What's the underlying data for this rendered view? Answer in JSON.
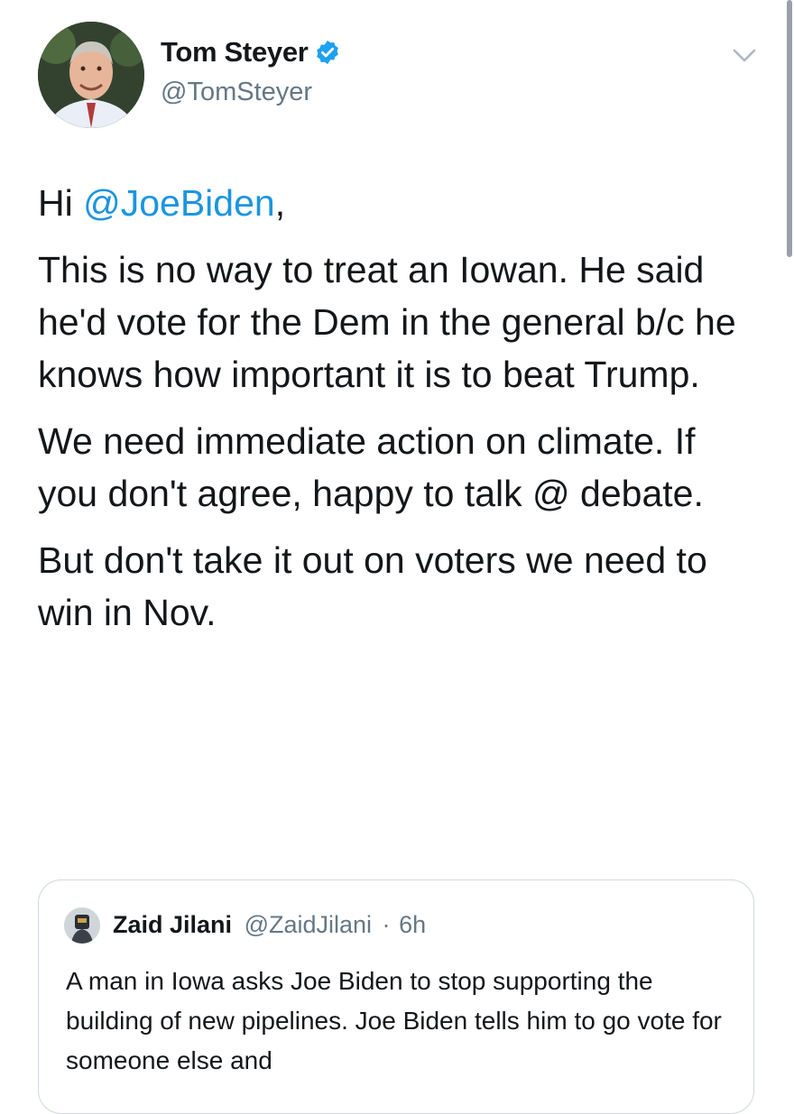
{
  "author": {
    "display_name": "Tom Steyer",
    "handle": "@TomSteyer",
    "verified": true
  },
  "tweet": {
    "greeting_prefix": "Hi ",
    "greeting_mention": "@JoeBiden",
    "greeting_suffix": ",",
    "paragraph_2": "This is no way to treat an Iowan. He said he'd vote for the Dem in the general b/c he knows how important it is to beat Trump.",
    "paragraph_3": "We need immediate action on climate. If you don't agree, happy to talk @ debate.",
    "paragraph_4": "But don't take it out on voters we need to win in Nov."
  },
  "quoted_tweet": {
    "display_name": "Zaid Jilani",
    "handle": "@ZaidJilani",
    "separator": "·",
    "time": "6h",
    "text": "A man in Iowa asks Joe Biden to stop supporting the building of new pipelines. Joe Biden tells him to go vote for someone else and"
  },
  "icons": {
    "verified": "verified-badge-icon",
    "menu": "chevron-down-icon"
  },
  "colors": {
    "mention": "#1b95e0",
    "secondary_text": "#657786",
    "verified_badge": "#1da1f2"
  }
}
